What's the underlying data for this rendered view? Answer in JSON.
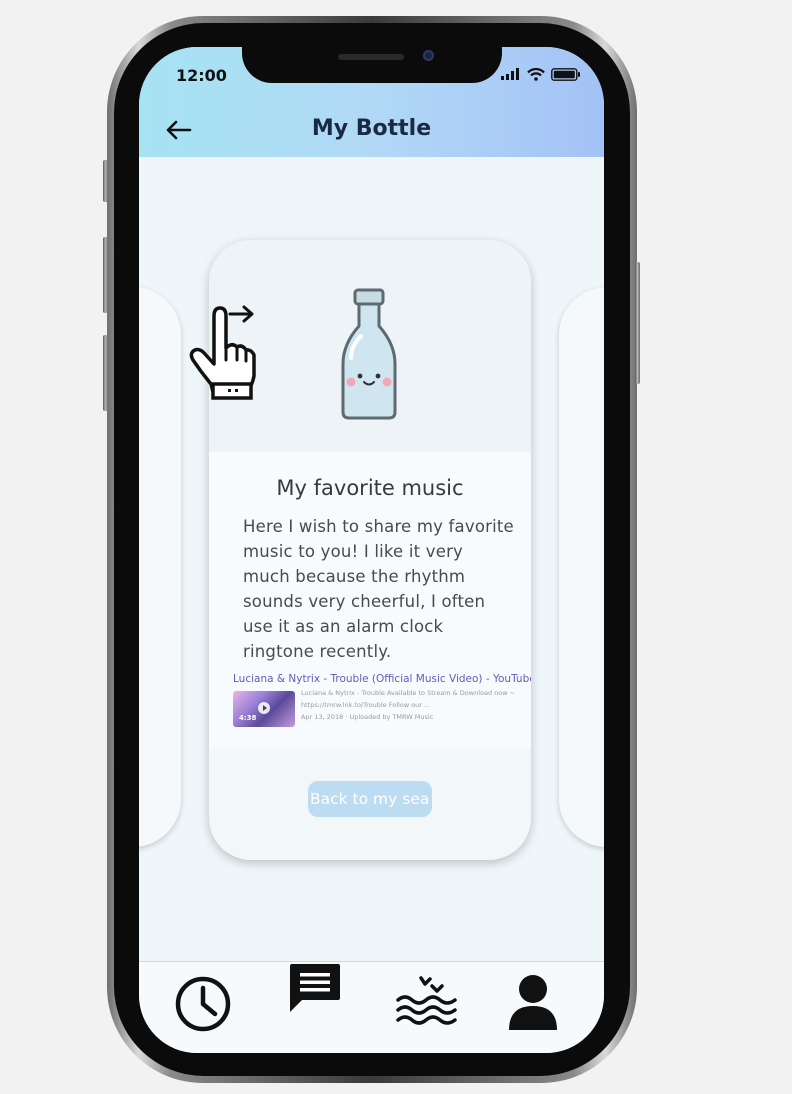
{
  "status_bar": {
    "time": "12:00"
  },
  "header": {
    "title": "My Bottle"
  },
  "card": {
    "title": "My favorite music",
    "body": "Here I wish to share my favorite music to you! I like it very much because the rhythm sounds very cheerful, I often use it as an alarm clock ringtone recently.",
    "link": {
      "title": "Luciana & Nytrix - Trouble (Official Music Video) - YouTube",
      "line1": "Luciana & Nytrix - Trouble Available to Stream & Download now ~",
      "line2": "https://tmrw.lnk.to/Trouble Follow our ...",
      "line3": "Apr 13, 2018 · Uploaded by TMRW Music",
      "duration": "4:38"
    },
    "button_label": "Back to my sea"
  },
  "tabs": [
    {
      "icon": "clock-icon"
    },
    {
      "icon": "chat-icon"
    },
    {
      "icon": "sea-icon"
    },
    {
      "icon": "profile-icon"
    }
  ],
  "colors": {
    "header_gradient_start": "#a6e3f3",
    "header_gradient_end": "#a4c2f6",
    "button_bg": "#bcdcf2",
    "link_color": "#6b58b8"
  }
}
